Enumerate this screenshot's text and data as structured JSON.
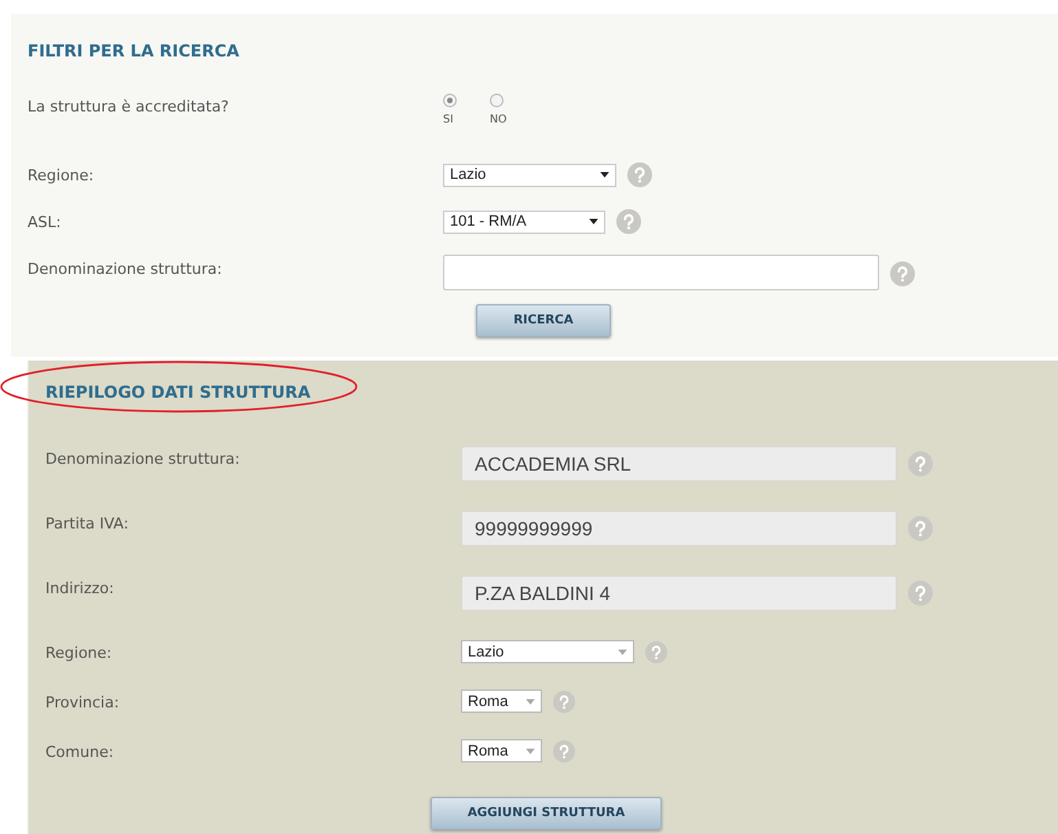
{
  "sections": [
    {
      "title": "FILTRI PER LA RICERCA",
      "annotated": false,
      "rows": [
        {
          "kind": "radio",
          "label": "La struttura è accreditata?",
          "options": [
            {
              "label": "SI",
              "selected": true
            },
            {
              "label": "NO",
              "selected": false
            }
          ]
        },
        {
          "kind": "select",
          "label": "Regione:",
          "value": "Lazio",
          "help": true
        },
        {
          "kind": "select",
          "label": "ASL:",
          "value": "101 - RM/A",
          "help": true
        },
        {
          "kind": "text",
          "label": "Denominazione struttura:",
          "disabled": false,
          "help": true
        }
      ],
      "button": "RICERCA"
    },
    {
      "title": "RIEPILOGO DATI STRUTTURA",
      "annotated": true,
      "rows": [
        {
          "kind": "text",
          "label": "Denominazione struttura:",
          "value": "ACCADEMIA SRL",
          "disabled": true,
          "help": true
        },
        {
          "kind": "text",
          "label": "Partita IVA:",
          "value": "99999999999",
          "disabled": true,
          "help": true
        },
        {
          "kind": "text",
          "label": "Indirizzo:",
          "value": "P.ZA BALDINI 4",
          "disabled": true,
          "help": true
        },
        {
          "kind": "select",
          "label": "Regione:",
          "value": "Lazio",
          "help": true
        },
        {
          "kind": "select",
          "label": "Provincia:",
          "value": "Roma",
          "help": true
        },
        {
          "kind": "select",
          "label": "Comune:",
          "value": "Roma",
          "help": true
        }
      ],
      "button": "AGGIUNGI STRUTTURA"
    }
  ]
}
